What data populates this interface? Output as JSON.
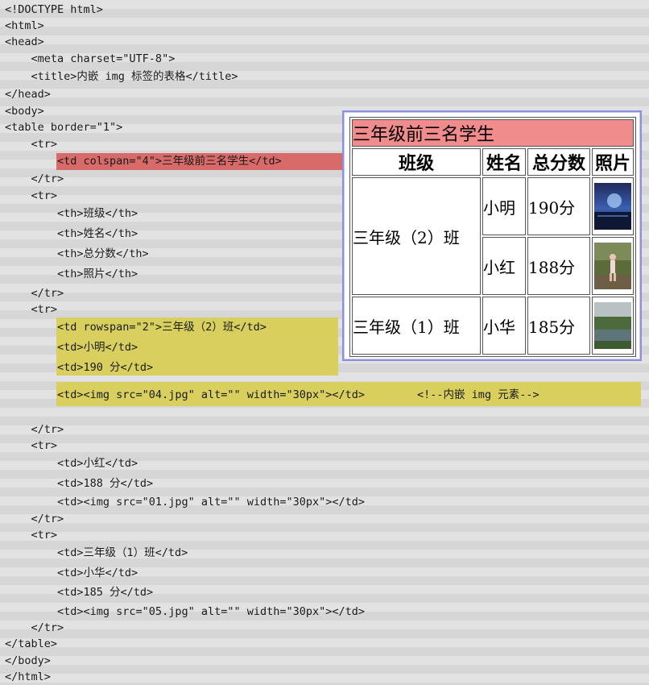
{
  "code_lines": [
    "<!DOCTYPE html>",
    "<html>",
    "<head>",
    "    <meta charset=\"UTF-8\">",
    "    <title>内嵌 img 标签的表格</title>",
    "</head>",
    "<body>",
    "<table border=\"1\">",
    "    <tr>",
    "        <td colspan=\"4\">三年级前三名学生</td>",
    "    </tr>",
    "    <tr>",
    "        <th>班级</th>",
    "        <th>姓名</th>",
    "        <th>总分数</th>",
    "        <th>照片</th>",
    "    </tr>",
    "    <tr>",
    "        <td rowspan=\"2\">三年级（2）班</td>",
    "        <td>小明</td>",
    "        <td>190 分</td>",
    "        <td><img src=\"04.jpg\" alt=\"\" width=\"30px\"></td>        <!--内嵌 img 元素-->",
    "    </tr>",
    "    <tr>",
    "        <td>小红</td>",
    "        <td>188 分</td>",
    "        <td><img src=\"01.jpg\" alt=\"\" width=\"30px\"></td>",
    "    </tr>",
    "    <tr>",
    "        <td>三年级（1）班</td>",
    "        <td>小华</td>",
    "        <td>185 分</td>",
    "        <td><img src=\"05.jpg\" alt=\"\" width=\"30px\"></td>",
    "    </tr>",
    "</table>",
    "</body>",
    "</html>"
  ],
  "preview": {
    "title": "三年级前三名学生",
    "headers": [
      "班级",
      "姓名",
      "总分数",
      "照片"
    ],
    "rows": [
      {
        "class": "三年级（2）班",
        "name": "小明",
        "score": "190分",
        "photo": "photo-lake-night"
      },
      {
        "class": "",
        "name": "小红",
        "score": "188分",
        "photo": "photo-girl-outdoor"
      },
      {
        "class": "三年级（1）班",
        "name": "小华",
        "score": "185分",
        "photo": "photo-lake-trees"
      }
    ]
  },
  "colors": {
    "code_background": "#dcdcdc",
    "highlight_red": "#d86a6a",
    "highlight_yellow": "#d8cf5e",
    "preview_title_background": "#f08c8c",
    "preview_border": "#8a8fe0"
  }
}
